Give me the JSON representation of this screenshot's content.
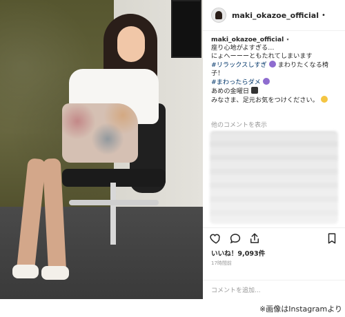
{
  "post": {
    "username": "maki_okazoe_official",
    "dot": "•",
    "caption": {
      "username": "maki_okazoe_official",
      "marker": "⋆",
      "lines": [
        "座り心地がよすぎる…",
        "にょへーーーともたれてしまいます",
        "#リラックスしすぎ",
        "まわりたくなる椅",
        "子！",
        "#まわったらダメ",
        "あめの金曜日",
        "みなさま、足元お気をつけください。"
      ]
    },
    "more_comments": "他のコメントを表示",
    "likes": "いいね！9,093件",
    "time": "17時間前",
    "comment_placeholder": "コメントを追加..."
  },
  "icons": {
    "like": "heart-icon",
    "comment": "comment-icon",
    "share": "share-icon",
    "save": "bookmark-icon"
  },
  "source_note": "※画像はInstagramより"
}
